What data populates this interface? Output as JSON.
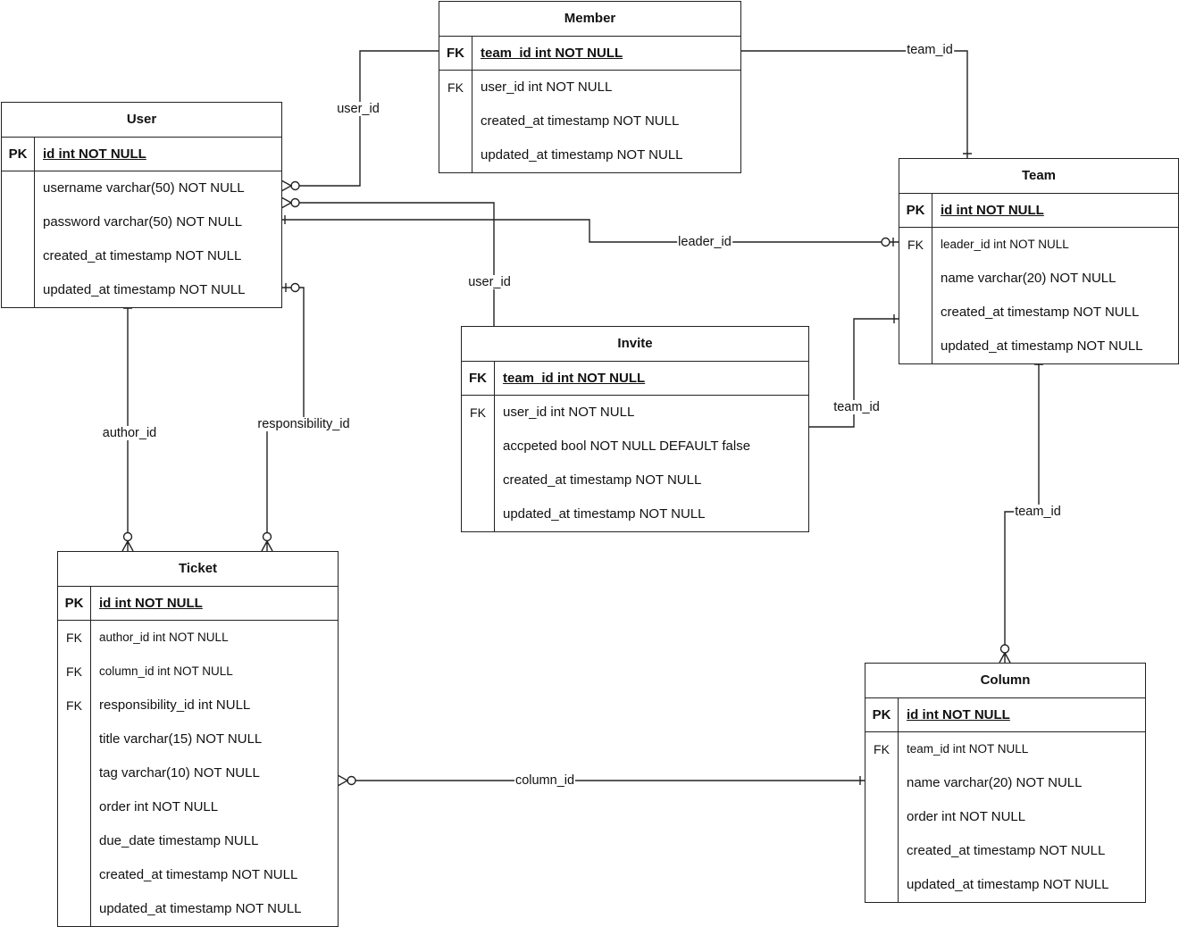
{
  "tables": {
    "member": {
      "title": "Member",
      "pk": {
        "key": "FK",
        "text": "team_id int NOT NULL"
      },
      "rows": [
        {
          "key": "FK",
          "text": "user_id int NOT NULL"
        },
        {
          "key": "",
          "text": "created_at timestamp NOT NULL"
        },
        {
          "key": "",
          "text": "updated_at timestamp NOT NULL"
        }
      ]
    },
    "user": {
      "title": "User",
      "pk": {
        "key": "PK",
        "text": "id int NOT NULL"
      },
      "rows": [
        {
          "key": "",
          "text": "username varchar(50) NOT NULL"
        },
        {
          "key": "",
          "text": "password varchar(50) NOT NULL"
        },
        {
          "key": "",
          "text": "created_at timestamp NOT NULL"
        },
        {
          "key": "",
          "text": "updated_at timestamp NOT NULL"
        }
      ]
    },
    "team": {
      "title": "Team",
      "pk": {
        "key": "PK",
        "text": "id int NOT NULL"
      },
      "rows": [
        {
          "key": "FK",
          "text": "leader_id int NOT NULL"
        },
        {
          "key": "",
          "text": "name varchar(20) NOT NULL"
        },
        {
          "key": "",
          "text": "created_at timestamp NOT NULL"
        },
        {
          "key": "",
          "text": "updated_at timestamp NOT NULL"
        }
      ]
    },
    "invite": {
      "title": "Invite",
      "pk": {
        "key": "FK",
        "text": "team_id int NOT NULL"
      },
      "rows": [
        {
          "key": "FK",
          "text": "user_id int NOT NULL"
        },
        {
          "key": "",
          "text": "accpeted bool NOT NULL DEFAULT false"
        },
        {
          "key": "",
          "text": "created_at timestamp NOT NULL"
        },
        {
          "key": "",
          "text": "updated_at timestamp NOT NULL"
        }
      ]
    },
    "ticket": {
      "title": "Ticket",
      "pk": {
        "key": "PK",
        "text": "id int NOT NULL"
      },
      "rows": [
        {
          "key": "FK",
          "text": "author_id int NOT NULL"
        },
        {
          "key": "FK",
          "text": "column_id int NOT NULL"
        },
        {
          "key": "FK",
          "text": "responsibility_id int NULL"
        },
        {
          "key": "",
          "text": "title varchar(15) NOT NULL"
        },
        {
          "key": "",
          "text": "tag varchar(10) NOT NULL"
        },
        {
          "key": "",
          "text": "order int NOT NULL"
        },
        {
          "key": "",
          "text": "due_date timestamp NULL"
        },
        {
          "key": "",
          "text": "created_at timestamp NOT NULL"
        },
        {
          "key": "",
          "text": "updated_at timestamp NOT NULL"
        }
      ]
    },
    "column": {
      "title": "Column",
      "pk": {
        "key": "PK",
        "text": "id int NOT NULL"
      },
      "rows": [
        {
          "key": "FK",
          "text": "team_id int NOT NULL"
        },
        {
          "key": "",
          "text": "name varchar(20) NOT NULL"
        },
        {
          "key": "",
          "text": "order int NOT NULL"
        },
        {
          "key": "",
          "text": "created_at timestamp NOT NULL"
        },
        {
          "key": "",
          "text": "updated_at timestamp NOT NULL"
        }
      ]
    }
  },
  "relations": [
    {
      "label": "team_id",
      "from": "member",
      "to": "team",
      "from_end": "none",
      "to_end": "one"
    },
    {
      "label": "user_id",
      "from": "user",
      "to": "member",
      "from_end": "zero-or-many",
      "to_end": "none"
    },
    {
      "label": "user_id",
      "from": "user",
      "to": "invite",
      "from_end": "zero-or-many",
      "to_end": "none"
    },
    {
      "label": "leader_id",
      "from": "user",
      "to": "team",
      "from_end": "one",
      "to_end": "zero-or-one"
    },
    {
      "label": "responsibility_id",
      "from": "user",
      "to": "ticket",
      "from_end": "zero-or-one",
      "to_end": "zero-or-many"
    },
    {
      "label": "author_id",
      "from": "user",
      "to": "ticket",
      "from_end": "one",
      "to_end": "zero-or-many"
    },
    {
      "label": "team_id",
      "from": "invite",
      "to": "team",
      "from_end": "none",
      "to_end": "one"
    },
    {
      "label": "team_id",
      "from": "team",
      "to": "column",
      "from_end": "one",
      "to_end": "zero-or-many"
    },
    {
      "label": "column_id",
      "from": "ticket",
      "to": "column",
      "from_end": "zero-or-many",
      "to_end": "one"
    }
  ]
}
